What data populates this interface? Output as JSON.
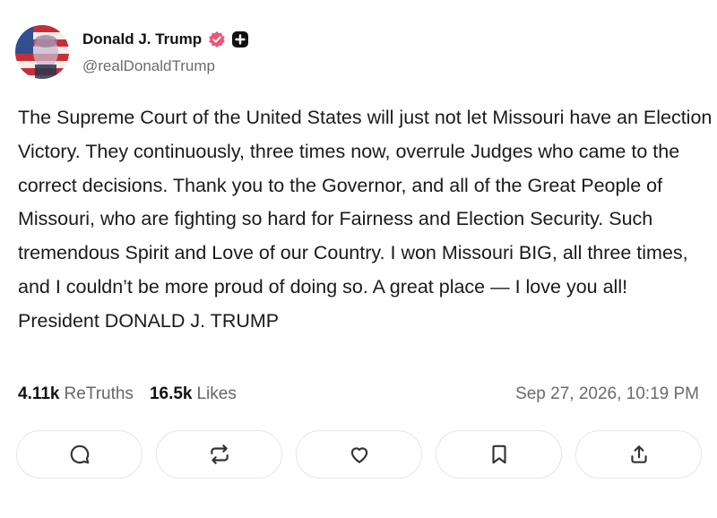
{
  "author": {
    "display_name": "Donald J. Trump",
    "handle": "@realDonaldTrump",
    "verified_badge_icon": "verified-check-icon",
    "extra_badge_icon": "plus-badge-icon"
  },
  "post": {
    "text": "The Supreme Court of the United States will just not let Missouri have an Election Victory. They continuously, three times now, overrule Judges who came to the correct decisions. Thank you to the Governor, and all of the Great People of Missouri, who are fighting so hard for Fairness and Election Security. Such tremendous Spirit and Love of our Country. I won Missouri BIG, all three times, and I couldn’t be more proud of doing so. A great place — I love you all! President DONALD J. TRUMP",
    "retruths_count": "4.11k",
    "retruths_label": "ReTruths",
    "likes_count": "16.5k",
    "likes_label": "Likes",
    "timestamp": "Sep 27, 2026, 10:19 PM"
  },
  "actions": [
    {
      "name": "reply",
      "icon": "comment-icon"
    },
    {
      "name": "retruth",
      "icon": "repost-icon"
    },
    {
      "name": "like",
      "icon": "heart-icon"
    },
    {
      "name": "bookmark",
      "icon": "bookmark-icon"
    },
    {
      "name": "share",
      "icon": "share-icon"
    }
  ],
  "colors": {
    "verified_badge": "#e9577a",
    "text": "#1a1a1a",
    "muted": "#6b6b6b",
    "button_border": "#e6e6e6"
  }
}
